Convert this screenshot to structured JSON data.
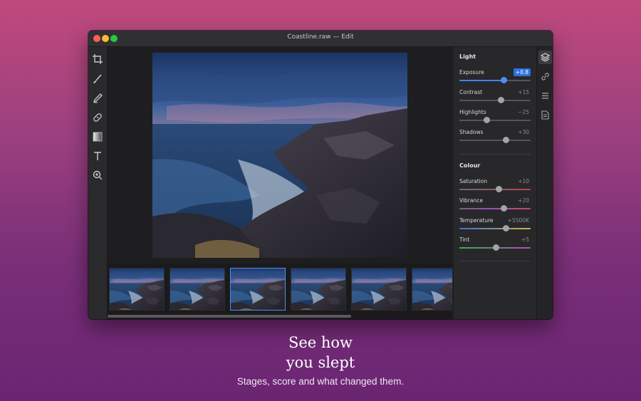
{
  "window": {
    "title": "Coastline.raw — Edit"
  },
  "toolbar": {
    "tools": [
      {
        "name": "crop-icon"
      },
      {
        "name": "brush-icon"
      },
      {
        "name": "pen-icon"
      },
      {
        "name": "heal-icon"
      },
      {
        "name": "gradient-icon"
      },
      {
        "name": "text-icon"
      },
      {
        "name": "zoom-icon"
      }
    ]
  },
  "panel": {
    "light": {
      "title": "Light",
      "adjustments": [
        {
          "label": "Exposure",
          "value": "+0.8",
          "level": 0.62,
          "active": true
        },
        {
          "label": "Contrast",
          "value": "+15",
          "level": 0.58
        },
        {
          "label": "Highlights",
          "value": "−25",
          "level": 0.38
        },
        {
          "label": "Shadows",
          "value": "+30",
          "level": 0.65
        }
      ]
    },
    "colour": {
      "title": "Colour",
      "adjustments": [
        {
          "label": "Saturation",
          "value": "+10",
          "level": 0.55
        },
        {
          "label": "Vibrance",
          "value": "+20",
          "level": 0.62
        },
        {
          "label": "Temperature",
          "value": "+5500K",
          "level": 0.65
        },
        {
          "label": "Tint",
          "value": "+5",
          "level": 0.51
        }
      ]
    }
  },
  "sidebar": {
    "buttons": [
      {
        "name": "layers-icon",
        "active": true
      },
      {
        "name": "link-icon"
      },
      {
        "name": "list-icon"
      },
      {
        "name": "document-icon"
      }
    ]
  },
  "filmstrip": {
    "count": 6,
    "selected_index": 2
  },
  "marketing": {
    "headline_line1": "See how",
    "headline_line2": "you slept",
    "subline": "Stages, score and what changed them."
  },
  "colors": {
    "accent": "#3f83f2",
    "background_top": "#bf4a7c",
    "background_bottom": "#6a2572"
  }
}
